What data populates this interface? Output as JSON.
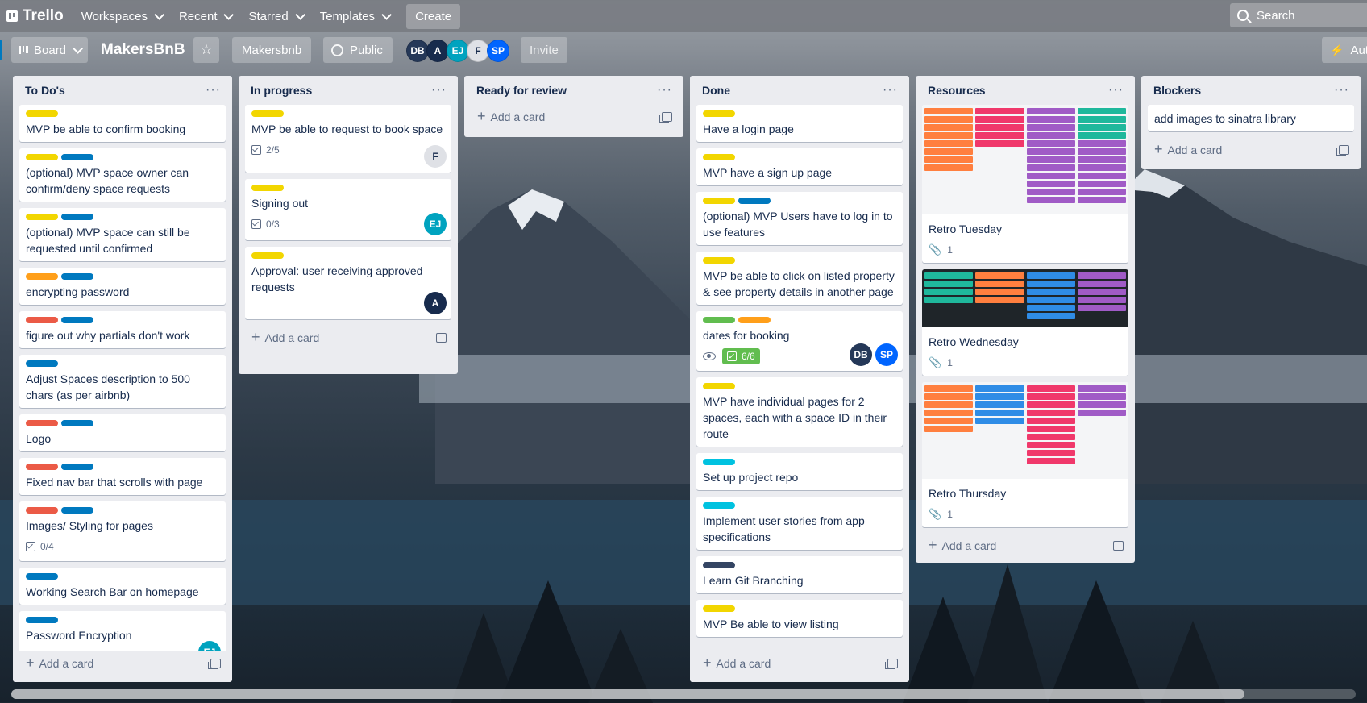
{
  "app": {
    "name": "Trello",
    "nav": [
      "Workspaces",
      "Recent",
      "Starred",
      "Templates"
    ],
    "create_label": "Create",
    "search_placeholder": "Search"
  },
  "board": {
    "view_label": "Board",
    "title": "MakersBnB",
    "workspace": "Makersbnb",
    "visibility": "Public",
    "invite_label": "Invite",
    "automation_label": "Auto",
    "members": [
      "DB",
      "A",
      "EJ",
      "F",
      "SP"
    ]
  },
  "lists": [
    {
      "title": "To Do's",
      "add_label": "Add a card",
      "cards": [
        {
          "labels": [
            "yellow"
          ],
          "title": "MVP be able to confirm booking"
        },
        {
          "labels": [
            "yellow",
            "blue"
          ],
          "title": "(optional) MVP space owner can confirm/deny space requests"
        },
        {
          "labels": [
            "yellow",
            "blue"
          ],
          "title": "(optional) MVP space can still be requested until confirmed"
        },
        {
          "labels": [
            "orange",
            "blue"
          ],
          "title": "encrypting password"
        },
        {
          "labels": [
            "red",
            "blue"
          ],
          "title": "figure out why partials don't work"
        },
        {
          "labels": [
            "blue"
          ],
          "title": "Adjust Spaces description to 500 chars (as per airbnb)"
        },
        {
          "labels": [
            "red",
            "blue"
          ],
          "title": "Logo"
        },
        {
          "labels": [
            "red",
            "blue"
          ],
          "title": "Fixed nav bar that scrolls with page"
        },
        {
          "labels": [
            "red",
            "blue"
          ],
          "title": "Images/ Styling for pages",
          "checklist": "0/4"
        },
        {
          "labels": [
            "blue"
          ],
          "title": "Working Search Bar on homepage"
        },
        {
          "labels": [
            "blue"
          ],
          "title": "Password Encryption",
          "members": [
            "EJ"
          ]
        }
      ]
    },
    {
      "title": "In progress",
      "add_label": "Add a card",
      "cards": [
        {
          "labels": [
            "yellow"
          ],
          "title": "MVP be able to request to book space",
          "checklist": "2/5",
          "members": [
            "F"
          ]
        },
        {
          "labels": [
            "yellow"
          ],
          "title": "Signing out",
          "checklist": "0/3",
          "members": [
            "EJ"
          ]
        },
        {
          "labels": [
            "yellow"
          ],
          "title": "Approval: user receiving approved requests",
          "members": [
            "A"
          ]
        }
      ]
    },
    {
      "title": "Ready for review",
      "add_label": "Add a card",
      "cards": []
    },
    {
      "title": "Done",
      "add_label": "Add a card",
      "cards": [
        {
          "labels": [
            "yellow"
          ],
          "title": "Have a login page"
        },
        {
          "labels": [
            "yellow"
          ],
          "title": "MVP have a sign up page"
        },
        {
          "labels": [
            "yellow",
            "blue"
          ],
          "title": "(optional) MVP Users have to log in to use features"
        },
        {
          "labels": [
            "yellow"
          ],
          "title": "MVP be able to click on listed property & see property details in another page"
        },
        {
          "labels": [
            "green",
            "orange"
          ],
          "title": "dates for booking",
          "watching": true,
          "checklist": "6/6",
          "checklist_complete": true,
          "members": [
            "DB",
            "SP"
          ]
        },
        {
          "labels": [
            "yellow"
          ],
          "title": "MVP have individual pages for 2 spaces, each with a space ID in their route"
        },
        {
          "labels": [
            "sky"
          ],
          "title": "Set up project repo"
        },
        {
          "labels": [
            "sky"
          ],
          "title": "Implement user stories from app specifications"
        },
        {
          "labels": [
            "navy"
          ],
          "title": "Learn Git Branching"
        },
        {
          "labels": [
            "yellow"
          ],
          "title": "MVP Be able to view listing"
        }
      ]
    },
    {
      "title": "Resources",
      "add_label": "Add a card",
      "cards": [
        {
          "title": "Retro Tuesday",
          "attachments": "1",
          "cover": "light"
        },
        {
          "title": "Retro Wednesday",
          "attachments": "1",
          "cover": "dark"
        },
        {
          "title": "Retro Thursday",
          "attachments": "1",
          "cover": "light"
        }
      ]
    },
    {
      "title": "Blockers",
      "add_label": "Add a card",
      "cards": [
        {
          "labels": [],
          "title": "add images to sinatra library"
        }
      ]
    }
  ]
}
